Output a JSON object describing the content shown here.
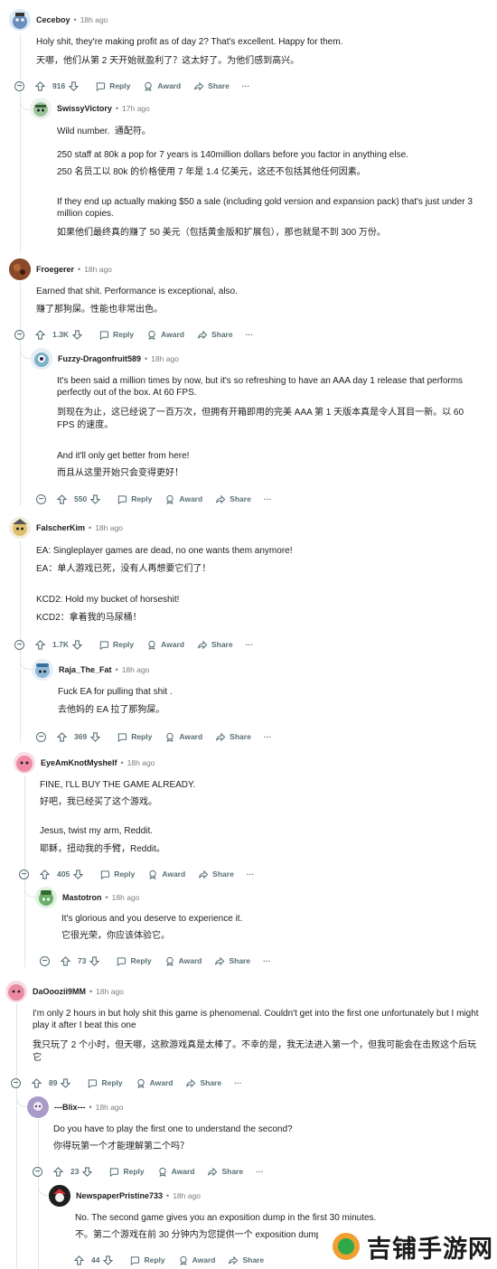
{
  "actions": {
    "reply": "Reply",
    "award": "Award",
    "share": "Share",
    "more": "···"
  },
  "comments": [
    {
      "user": "Ceceboy",
      "time": "18h ago",
      "en": "Holy shit, they're making profit as of day 2? That's excellent. Happy for them.",
      "zh": "天哪，他们从第 2 天开始就盈利了？这太好了。为他们感到高兴。",
      "votes": "916"
    },
    {
      "user": "SwissyVictory",
      "time": "17h ago",
      "en1": "Wild number.",
      "zh1": "通配符。",
      "en2": "250 staff at 80k a pop for 7 years is 140million dollars before you factor in anything else.",
      "zh2": "250 名员工以 80k 的价格使用 7 年是 1.4 亿美元，这还不包括其他任何因素。",
      "en3": "If they end up actually making $50 a sale (including gold version and expansion pack) that's just under 3 million copies.",
      "zh3": "如果他们最终真的赚了 50 美元（包括黄金版和扩展包），那也就是不到 300 万份。"
    },
    {
      "user": "Froegerer",
      "time": "18h ago",
      "en": "Earned that shit. Performance is exceptional, also.",
      "zh": "赚了那狗屎。性能也非常出色。",
      "votes": "1.3K"
    },
    {
      "user": "Fuzzy-Dragonfruit589",
      "time": "18h ago",
      "en1": "It's been said a million times by now, but it's so refreshing to have an AAA day 1 release that performs perfectly out of the box. At 60 FPS.",
      "zh1": "到现在为止，这已经说了一百万次，但拥有开箱即用的完美 AAA 第 1 天版本真是令人耳目一新。以 60 FPS 的速度。",
      "en2": "And it'll only get better from here!",
      "zh2": "而且从这里开始只会变得更好！",
      "votes": "550"
    },
    {
      "user": "FalscherKim",
      "time": "18h ago",
      "en1": "EA: Singleplayer games are dead, no one wants them anymore!",
      "zh1": "EA：单人游戏已死，没有人再想要它们了！",
      "en2": "KCD2: Hold my bucket of horseshit!",
      "zh2": "KCD2：拿着我的马尿桶！",
      "votes": "1.7K"
    },
    {
      "user": "Raja_The_Fat",
      "time": "18h ago",
      "en": "Fuck EA for pulling that shit .",
      "zh": "去他妈的 EA 拉了那狗屎。",
      "votes": "369"
    },
    {
      "user": "EyeAmKnotMyshelf",
      "time": "18h ago",
      "en1": "FINE, I'LL BUY THE GAME ALREADY.",
      "zh1": "好吧，我已经买了这个游戏。",
      "en2": "Jesus, twist my arm, Reddit.",
      "zh2": "耶稣，扭动我的手臂，Reddit。",
      "votes": "405"
    },
    {
      "user": "Mastotron",
      "time": "18h ago",
      "en": "It's glorious and you deserve to experience it.",
      "zh": "它很光荣，你应该体验它。",
      "votes": "73"
    },
    {
      "user": "DaOoozii9MM",
      "time": "18h ago",
      "en": "I'm only 2 hours in but holy shit this game is phenomenal. Couldn't get into the first one unfortunately but I might play it after I beat this one",
      "zh": "我只玩了 2 个小时，但天哪，这款游戏真是太棒了。不幸的是，我无法进入第一个，但我可能会在击败这个后玩它",
      "votes": "89"
    },
    {
      "user": "---Blix---",
      "time": "18h ago",
      "en": "Do you have to play the first one to understand the second?",
      "zh": "你得玩第一个才能理解第二个吗？",
      "votes": "23"
    },
    {
      "user": "NewspaperPristine733",
      "time": "18h ago",
      "en": "No. The second game gives you an exposition dump in the first 30 minutes.",
      "zh": "不。第二个游戏在前 30 分钟内为您提供一个 exposition dump。",
      "votes": "44"
    }
  ],
  "watermark": {
    "text": "吉铺手游网"
  }
}
